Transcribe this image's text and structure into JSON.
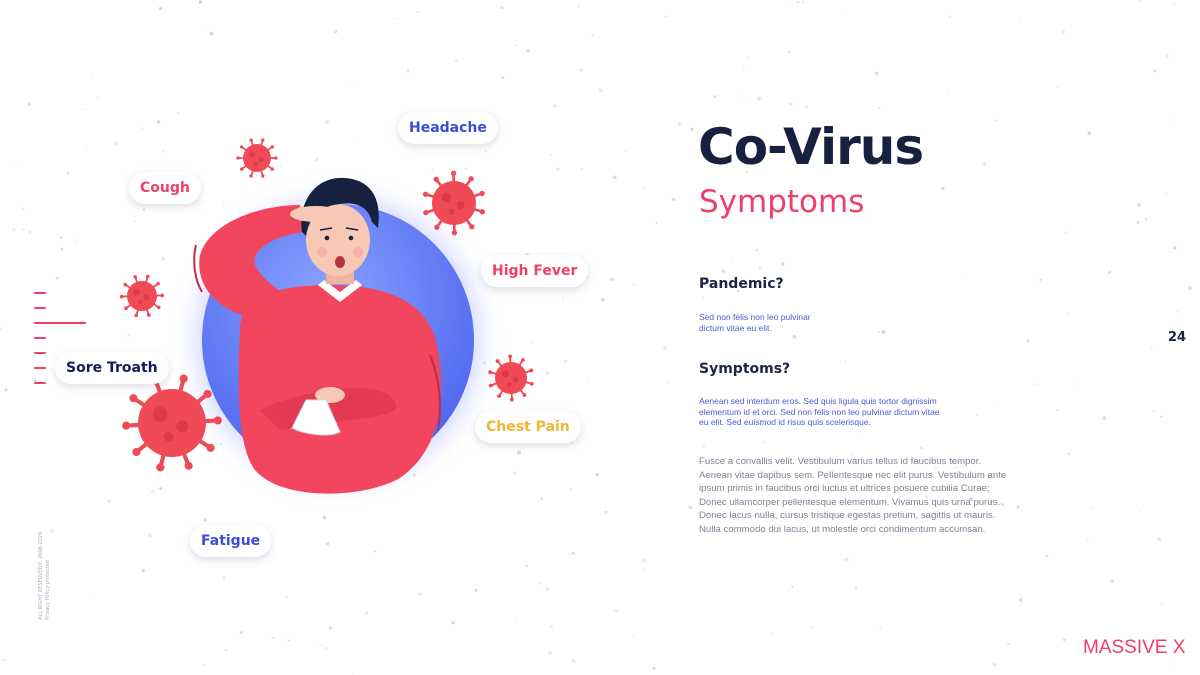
{
  "slide": {
    "title": "Co-Virus",
    "subtitle": "Symptoms",
    "page_number": "24",
    "brand": "MASSIVE X",
    "legal_line1": "ALL RIGHT RESERVED© 2008-2020",
    "legal_line2": "Privacy Policy protected"
  },
  "symptom_tags": {
    "headache": "Headache",
    "cough": "Cough",
    "high_fever": "High Fever",
    "sore_throat": "Sore Troath",
    "chest_pain": "Chest Pain",
    "fatigue": "Fatigue"
  },
  "sections": {
    "pandemic_heading": "Pandemic?",
    "pandemic_text_1": "Sed non felis non leo pulvinar",
    "pandemic_text_2": "dictum vitae eu elit.",
    "symptoms_heading": "Symptoms?",
    "symptoms_text_1": "Aenean sed interdum eros. Sed quis ligula quis tortor dignissim",
    "symptoms_text_2": "elementum id et orci. Sed non felis non leo pulvinar dictum vitae",
    "symptoms_text_3": "eu elit. Sed euismod id risus quis scelerisque.",
    "body_text": "Fusce a convallis velit. Vestibulum varius tellus id faucibus tempor. Aenean vitae dapibus sem. Pellentesque nec elit purus. Vestibulum ante ipsum primis in faucibus orci luctus et ultrices posuere cubilia Curae; Donec ullamcorper pellentesque elementum. Vivamus quis urna purus. Donec lacus nulla, cursus tristique egestas pretium, sagittis ut mauris. Nulla commodo dui lacus, ut molestie orci condimentum accumsan."
  },
  "colors": {
    "navy": "#16213f",
    "pink": "#ef3f68",
    "blue": "#4c5bd6",
    "virus": "#ef4a55",
    "tag_yellow": "#f2b632"
  },
  "icons": [
    "virus-icon",
    "person-illustration"
  ]
}
